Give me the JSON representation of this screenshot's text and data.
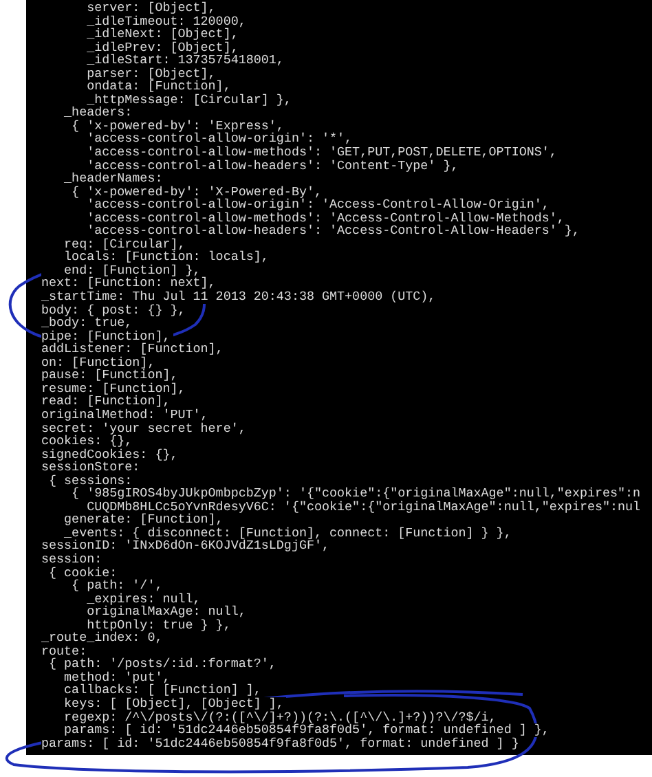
{
  "terminal": {
    "lines": [
      "      server: [Object],",
      "      _idleTimeout: 120000,",
      "      _idleNext: [Object],",
      "      _idlePrev: [Object],",
      "      _idleStart: 1373575418001,",
      "      parser: [Object],",
      "      ondata: [Function],",
      "      _httpMessage: [Circular] },",
      "   _headers:",
      "    { 'x-powered-by': 'Express',",
      "      'access-control-allow-origin': '*',",
      "      'access-control-allow-methods': 'GET,PUT,POST,DELETE,OPTIONS',",
      "      'access-control-allow-headers': 'Content-Type' },",
      "   _headerNames:",
      "    { 'x-powered-by': 'X-Powered-By',",
      "      'access-control-allow-origin': 'Access-Control-Allow-Origin',",
      "      'access-control-allow-methods': 'Access-Control-Allow-Methods',",
      "      'access-control-allow-headers': 'Access-Control-Allow-Headers' },",
      "   req: [Circular],",
      "   locals: [Function: locals],",
      "   end: [Function] },",
      "next: [Function: next],",
      "_startTime: Thu Jul 11 2013 20:43:38 GMT+0000 (UTC),",
      "body: { post: {} },",
      "_body: true,",
      "pipe: [Function],",
      "addListener: [Function],",
      "on: [Function],",
      "pause: [Function],",
      "resume: [Function],",
      "read: [Function],",
      "originalMethod: 'PUT',",
      "secret: 'your secret here',",
      "cookies: {},",
      "signedCookies: {},",
      "sessionStore:",
      " { sessions:",
      "    { '985gIROS4byJUkpOmbpcbZyp': '{\"cookie\":{\"originalMaxAge\":null,\"expires\":n",
      "      CUQDMb8HLCc5oYvnRdesyV6C: '{\"cookie\":{\"originalMaxAge\":null,\"expires\":nul",
      "   generate: [Function],",
      "   _events: { disconnect: [Function], connect: [Function] } },",
      "sessionID: 'INxD6dOn-6KOJVdZ1sLDgjGF',",
      "session:",
      " { cookie:",
      "    { path: '/',",
      "      _expires: null,",
      "      originalMaxAge: null,",
      "      httpOnly: true } },",
      "_route_index: 0,",
      "route:",
      " { path: '/posts/:id.:format?',",
      "   method: 'put',",
      "   callbacks: [ [Function] ],",
      "   keys: [ [Object], [Object] ],",
      "   regexp: /^\\/posts\\/(?:([^\\/]+?))(?:\\.([^\\/\\.]+?))?\\/?$/i,",
      "   params: [ id: '51dc2446eb50854f9fa8f0d5', format: undefined ] },",
      "params: [ id: '51dc2446eb50854f9fa8f0d5', format: undefined ] }"
    ]
  }
}
